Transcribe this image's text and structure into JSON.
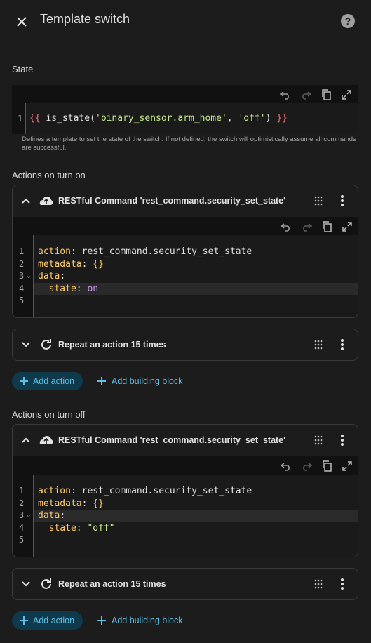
{
  "header": {
    "title": "Template switch"
  },
  "state": {
    "label": "State",
    "line_number": "1",
    "code_open": "{{ ",
    "code_fn": "is_state(",
    "code_arg1": "'binary_sensor.arm_home'",
    "code_comma": ", ",
    "code_arg2": "'off'",
    "code_close_paren": ") ",
    "code_close": "}}",
    "helper": "Defines a template to set the state of the switch. If not defined, the switch will optimistically assume all commands are successful."
  },
  "turn_on": {
    "label": "Actions on turn on",
    "command_title": "RESTful Command 'rest_command.security_set_state'",
    "code": {
      "lines": [
        "1",
        "2",
        "3",
        "4",
        "5"
      ],
      "l1_key": "action",
      "l1_val": "rest_command.security_set_state",
      "l2_key": "metadata",
      "l2_val": "{}",
      "l3_key": "data",
      "l4_key": "state",
      "l4_val": "on"
    },
    "repeat_title": "Repeat an action 15 times",
    "add_action": "Add action",
    "add_block": "Add building block"
  },
  "turn_off": {
    "label": "Actions on turn off",
    "command_title": "RESTful Command 'rest_command.security_set_state'",
    "code": {
      "lines": [
        "1",
        "2",
        "3",
        "4",
        "5"
      ],
      "l1_key": "action",
      "l1_val": "rest_command.security_set_state",
      "l2_key": "metadata",
      "l2_val": "{}",
      "l3_key": "data",
      "l4_key": "state",
      "l4_val": "\"off\""
    },
    "repeat_title": "Repeat an action 15 times",
    "add_action": "Add action",
    "add_block": "Add building block"
  },
  "colors": {
    "accent": "#5fc1ea",
    "pill_bg": "#0e3a4c",
    "background": "#1c1c1c",
    "editor_bg": "#111111"
  },
  "icons": [
    "close-icon",
    "help-icon",
    "undo-icon",
    "redo-icon",
    "copy-icon",
    "fullscreen-icon",
    "chevron-up-icon",
    "chevron-down-icon",
    "cloud-upload-icon",
    "repeat-icon",
    "drag-handle-icon",
    "more-vert-icon",
    "plus-icon"
  ]
}
